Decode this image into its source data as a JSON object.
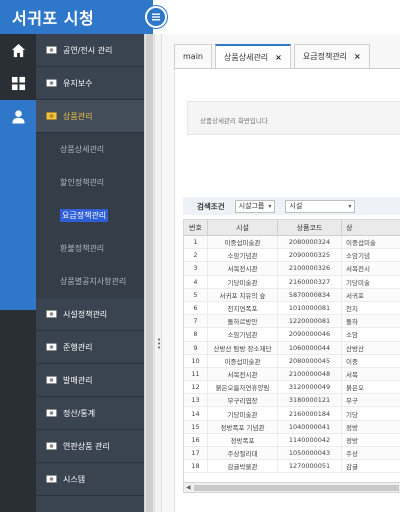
{
  "app": {
    "title": "서귀포 시청"
  },
  "sidebar": {
    "menus_top": [
      {
        "label": "공연/전시 관리"
      },
      {
        "label": "유지보수"
      }
    ],
    "open_menu": {
      "label": "상품관리"
    },
    "submenu": [
      {
        "label": "상품상세관리"
      },
      {
        "label": "할인정책관리"
      },
      {
        "label": "요금정책관리"
      },
      {
        "label": "환불정책관리"
      },
      {
        "label": "상품별공지사항관리"
      }
    ],
    "menus_bottom": [
      {
        "label": "시설정책관리"
      },
      {
        "label": "준행관리"
      },
      {
        "label": "발매관리"
      },
      {
        "label": "정산/통계"
      },
      {
        "label": "연판상품 관리"
      },
      {
        "label": "시스템"
      }
    ]
  },
  "tabs": [
    {
      "label": "main"
    },
    {
      "label": "상품상세관리",
      "close": "×"
    },
    {
      "label": "요금정책관리",
      "close": "×"
    }
  ],
  "info": {
    "text": "상품상세관리 화면입니다"
  },
  "search": {
    "label": "검색조건",
    "group_select": "시설그룹",
    "facility_select": "시설"
  },
  "grid": {
    "columns": [
      "번호",
      "시설",
      "상품코드",
      "상"
    ],
    "rows": [
      [
        "1",
        "이중섭미술관",
        "2080000324",
        "이중섭미술"
      ],
      [
        "2",
        "소암기념관",
        "2090000325",
        "소암기념"
      ],
      [
        "3",
        "서복전시관",
        "2100000326",
        "서복전시"
      ],
      [
        "4",
        "기당미술관",
        "2160000327",
        "기당미술"
      ],
      [
        "5",
        "서귀포 치유의 숲",
        "5870000834",
        "서귀포"
      ],
      [
        "6",
        "천지연폭포",
        "1010000081",
        "천지"
      ],
      [
        "7",
        "돌하르방안",
        "1220000081",
        "돌하"
      ],
      [
        "8",
        "소암기념관",
        "2090000046",
        "소암"
      ],
      [
        "9",
        "산방산 탐방 장소재단",
        "1060000044",
        "산방산"
      ],
      [
        "10",
        "이중섭미술관",
        "2080000045",
        "이중"
      ],
      [
        "11",
        "서복전시관",
        "2100000048",
        "서복"
      ],
      [
        "12",
        "붉은오름자연휴양림",
        "3120000049",
        "붉은오"
      ],
      [
        "13",
        "무구리엽장",
        "3180000121",
        "무구"
      ],
      [
        "14",
        "기당미술관",
        "2160000184",
        "기당"
      ],
      [
        "15",
        "정방폭포 기념관",
        "1040000041",
        "정방"
      ],
      [
        "16",
        "정방폭포",
        "1140000042",
        "정방"
      ],
      [
        "17",
        "주상절리대",
        "1050000043",
        "주상"
      ],
      [
        "18",
        "감귤박물관",
        "1270000051",
        "감귤"
      ]
    ]
  },
  "colors": {
    "brand": "#2f77c9",
    "sidebar_bg": "#3a4350",
    "rail_bg": "#2a2f36",
    "open_menu_text": "#f0c040",
    "selected_sub": "#2f5fd6"
  }
}
